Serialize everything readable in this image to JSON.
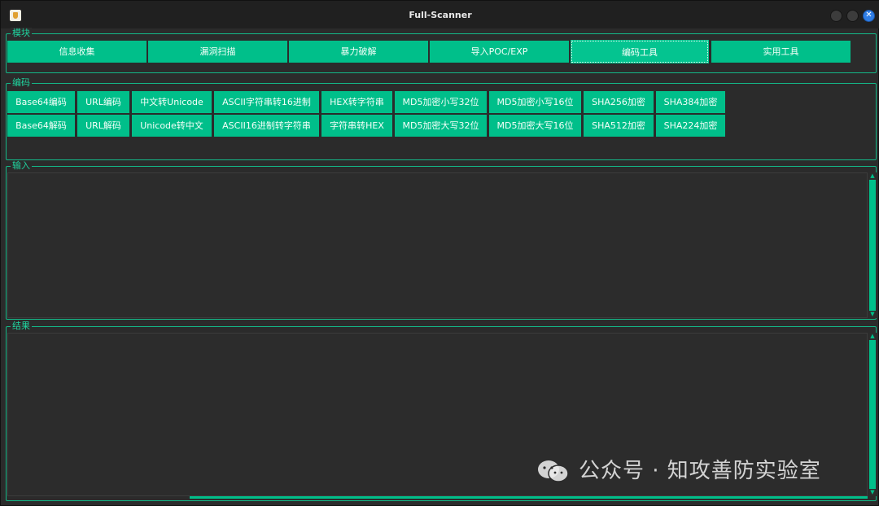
{
  "window": {
    "title": "Full-Scanner",
    "close_glyph": "✕"
  },
  "module_group": {
    "label": "模块",
    "tabs": [
      {
        "label": "信息收集",
        "active": false
      },
      {
        "label": "漏洞扫描",
        "active": false
      },
      {
        "label": "暴力破解",
        "active": false
      },
      {
        "label": "导入POC/EXP",
        "active": false
      },
      {
        "label": "编码工具",
        "active": true
      },
      {
        "label": "实用工具",
        "active": false
      }
    ]
  },
  "encode_group": {
    "label": "编码",
    "row1": [
      "Base64编码",
      "URL编码",
      "中文转Unicode",
      "ASCII字符串转16进制",
      "HEX转字符串",
      "MD5加密小写32位",
      "MD5加密小写16位",
      "SHA256加密",
      "SHA384加密"
    ],
    "row2": [
      "Base64解码",
      "URL解码",
      "Unicode转中文",
      "ASCII16进制转字符串",
      "字符串转HEX",
      "MD5加密大写32位",
      "MD5加密大写16位",
      "SHA512加密",
      "SHA224加密"
    ]
  },
  "input_group": {
    "label": "输入",
    "value": ""
  },
  "result_group": {
    "label": "结果",
    "value": ""
  },
  "watermark": {
    "text": "公众号 · 知攻善防实验室",
    "icon": "wechat-icon"
  },
  "colors": {
    "accent": "#00bf8a",
    "background": "#2b2b2b",
    "titlebar": "#202020"
  }
}
